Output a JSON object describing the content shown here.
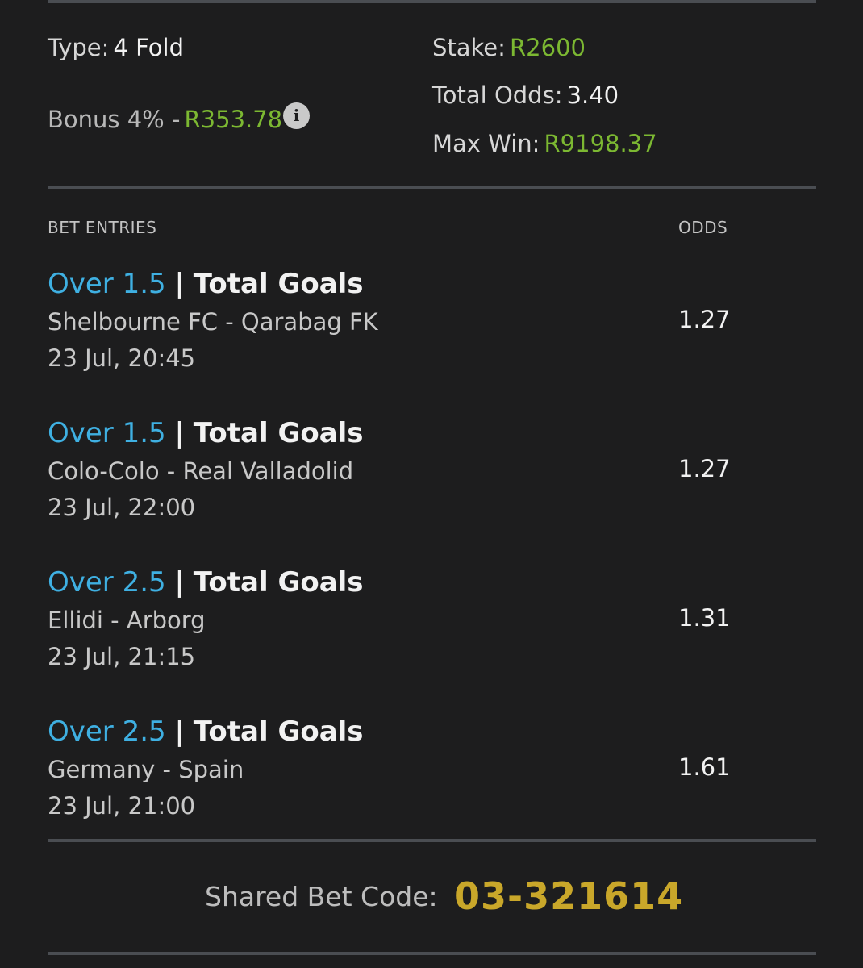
{
  "summary": {
    "type_label": "Type:",
    "type_value": "4 Fold",
    "bonus_label": "Bonus 4% -",
    "bonus_value": "R353.78",
    "stake_label": "Stake:",
    "stake_value": "R2600",
    "total_odds_label": "Total Odds:",
    "total_odds_value": "3.40",
    "max_win_label": "Max Win:",
    "max_win_value": "R9198.37"
  },
  "icons": {
    "info": "info-icon"
  },
  "colors": {
    "background": "#1d1d1e",
    "divider": "#4a4d52",
    "green": "#7cb832",
    "blue": "#3fb0e2",
    "gold": "#c9a72a"
  },
  "headers": {
    "bet_entries": "BET ENTRIES",
    "odds": "ODDS"
  },
  "entries": [
    {
      "selection": "Over 1.5",
      "separator": "|",
      "market": "Total Goals",
      "match": "Shelbourne FC - Qarabag FK",
      "datetime": "23 Jul, 20:45",
      "odds": "1.27"
    },
    {
      "selection": "Over 1.5",
      "separator": "|",
      "market": "Total Goals",
      "match": "Colo-Colo - Real Valladolid",
      "datetime": "23 Jul, 22:00",
      "odds": "1.27"
    },
    {
      "selection": "Over 2.5",
      "separator": "|",
      "market": "Total Goals",
      "match": "Ellidi - Arborg",
      "datetime": "23 Jul, 21:15",
      "odds": "1.31"
    },
    {
      "selection": "Over 2.5",
      "separator": "|",
      "market": "Total Goals",
      "match": "Germany - Spain",
      "datetime": "23 Jul, 21:00",
      "odds": "1.61"
    }
  ],
  "shared": {
    "label": "Shared Bet Code:",
    "code": "03-321614"
  }
}
